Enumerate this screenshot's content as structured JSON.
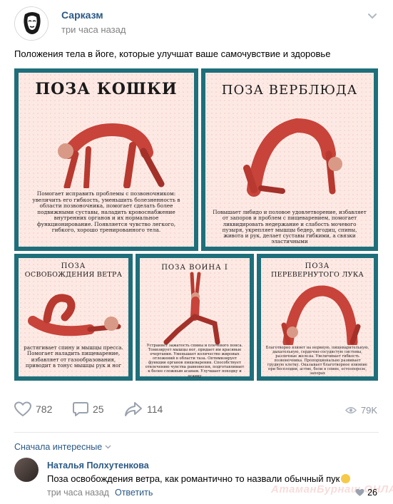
{
  "post": {
    "author": "Сарказм",
    "time": "три часа назад",
    "text": "Положения тела в йоге, которые улучшат ваше самочувствие и здоровье"
  },
  "cards": [
    {
      "title": "ПОЗА КОШКИ",
      "desc": "Помогает исправить проблемы с позвоночником: увеличить его гибкость, уменьшить болезненность в области позвоночника, помогает сделать более подвижными суставы, наладить кровоснабжение внутренних органов и их нормальное функционирование. Появляется чувство легкого, гибкого, хорошо тренированного тела."
    },
    {
      "title": "ПОЗА ВЕРБЛЮДА",
      "desc": "Повышает либидо и половое удовлетворение, избавляет от запоров и проблем с пищеварением, помогает ликвидировать недержание и слабость мочевого пузыря, укрепляет мышцы бедер, ягодиц, спины, живота и рук, делает суставы гибкими, а связки эластичными"
    },
    {
      "title_line1": "ПОЗА",
      "title_line2": "ОСВОБОЖДЕНИЯ ВЕТРА",
      "desc": "растягивает спину и мышцы пресса. Помогает наладить пищеварение, избавляет от газообразования, приводит в тонус мышцы рук и ног"
    },
    {
      "title": "ПОЗА ВОИНА I",
      "desc": "Устраняет зажатость спины и плечевого пояса. Тонизирует мышцы ног, придает им красивые очертания. Уменьшает количество жировых отложений в области таза. Оптимизирует функции органов пищеварения. Способствует отвлечению чувства равновесия, подготавливает к более сложным асанам. Улучшает походку и осанку"
    },
    {
      "title_line1": "ПОЗА",
      "title_line2": "ПЕРЕВЕРНУТОГО ЛУКА",
      "desc": "Благотворно влияет на нервную, пищеварительную, дыхательную, сердечно-сосудистую системы, различные железы. Увеличивает гибкость позвоночника. Пропорционально развивает грудную клетку. Оказывает благотворное влияние при бесплодии, астме, боли в спине, остеопорозе, запорах"
    }
  ],
  "actions": {
    "likes": "782",
    "comments": "25",
    "shares": "114",
    "views": "79K"
  },
  "comments_section": {
    "sort_label": "Сначала интересные",
    "comment": {
      "author": "Наталья Полхутенкова",
      "text": "Поза освобождения ветра, как романтично то назвали обычный пук",
      "time": "три часа назад",
      "reply_label": "Ответить",
      "likes": "26"
    },
    "watermark": "АтаманБурнаш.ОНЛАЙН"
  },
  "colors": {
    "link": "#2a5885",
    "card_frame": "#1e6f7b",
    "card_bg": "#fde9e4",
    "muscle": "#c8433a"
  },
  "icons": [
    "heart-icon",
    "comment-icon",
    "share-icon",
    "eye-icon",
    "chevron-down-icon",
    "emoji-icon"
  ]
}
